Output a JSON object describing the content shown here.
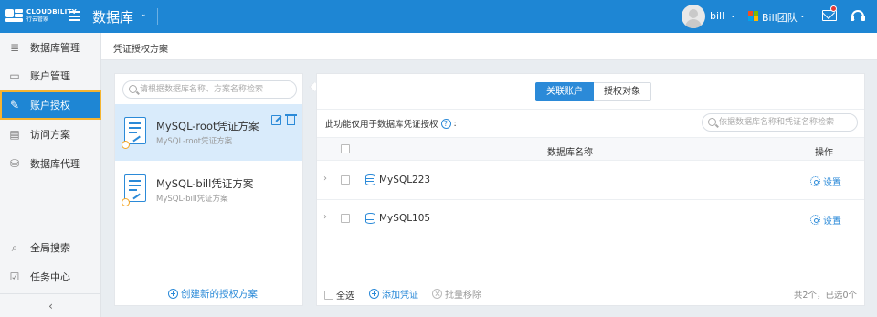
{
  "topbar": {
    "logo_text": "CLOUDBILITY",
    "logo_sub": "行云管家",
    "app_title": "数据库",
    "user_name": "bill",
    "team_name": "Bill团队"
  },
  "sidebar": {
    "items": [
      {
        "label": "数据库管理",
        "icon": "database-icon"
      },
      {
        "label": "账户管理",
        "icon": "id-card-icon"
      },
      {
        "label": "账户授权",
        "icon": "authorize-icon"
      },
      {
        "label": "访问方案",
        "icon": "document-icon"
      },
      {
        "label": "数据库代理",
        "icon": "database-proxy-icon"
      }
    ],
    "bottom_items": [
      {
        "label": "全局搜索",
        "icon": "search-icon"
      },
      {
        "label": "任务中心",
        "icon": "task-icon"
      }
    ],
    "collapse_label": "‹"
  },
  "page": {
    "title": "凭证授权方案"
  },
  "left_panel": {
    "search_placeholder": "请根据数据库名称、方案名称检索",
    "schemes": [
      {
        "name": "MySQL-root凭证方案",
        "sub": "MySQL-root凭证方案",
        "selected": true
      },
      {
        "name": "MySQL-bill凭证方案",
        "sub": "MySQL-bill凭证方案",
        "selected": false
      }
    ],
    "create_label": "创建新的授权方案"
  },
  "right_panel": {
    "tabs": [
      {
        "label": "关联账户",
        "active": true
      },
      {
        "label": "授权对象",
        "active": false
      }
    ],
    "hint": "此功能仅用于数据库凭证授权",
    "hint_suffix": ":",
    "help_glyph": "?",
    "search_placeholder": "依据数据库名称和凭证名称检索",
    "columns": {
      "name": "数据库名称",
      "op": "操作"
    },
    "rows": [
      {
        "db_name": "MySQL223",
        "action": "设置"
      },
      {
        "db_name": "MySQL105",
        "action": "设置"
      }
    ],
    "footer": {
      "select_all": "全选",
      "add_credential": "添加凭证",
      "bulk_remove": "批量移除",
      "count_text": "共2个，已选0个"
    }
  },
  "colors": {
    "primary": "#1e86d4",
    "link": "#2b8ad8",
    "highlight_border": "#f5b430",
    "selected_row": "#d9ebfb"
  }
}
